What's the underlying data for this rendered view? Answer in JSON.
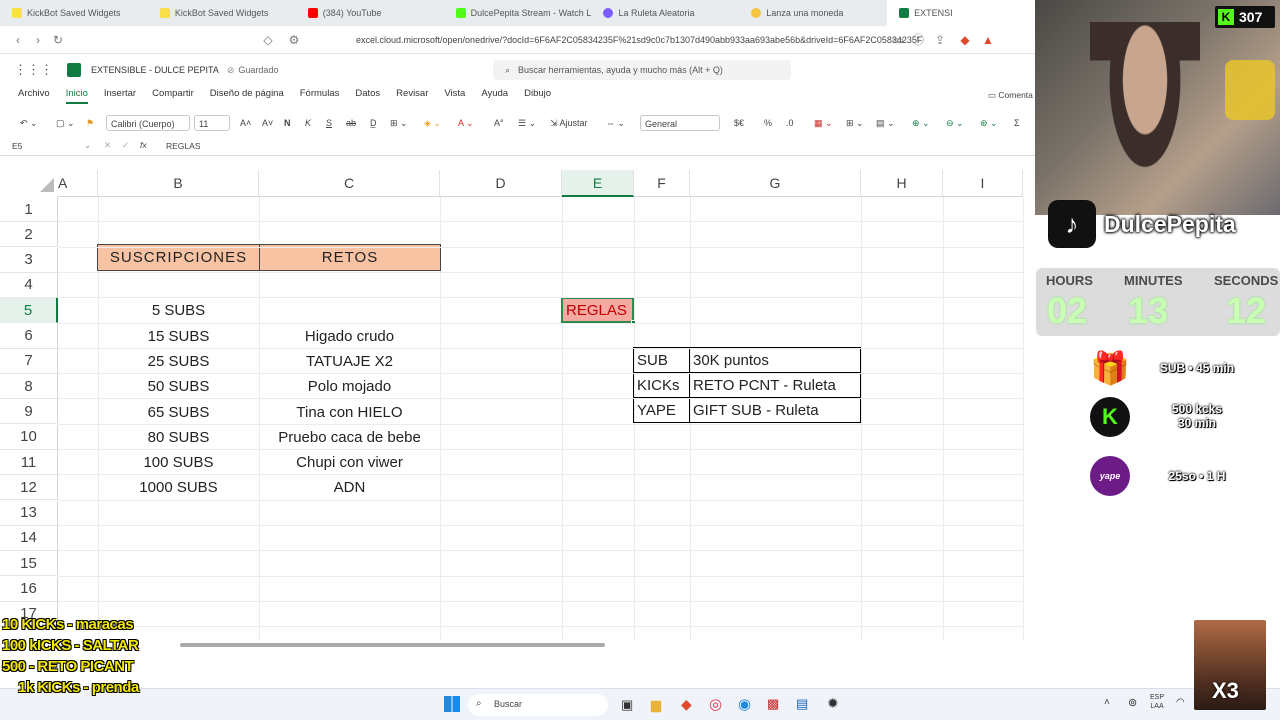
{
  "browser": {
    "tabs": [
      {
        "label": "KickBot Saved Widgets",
        "color": "#f7e04a"
      },
      {
        "label": "KickBot Saved Widgets",
        "color": "#f7e04a"
      },
      {
        "label": "(384) YouTube",
        "color": "#ff0000"
      },
      {
        "label": "DulcePepita Stream - Watch Live",
        "color": "#53fc18"
      },
      {
        "label": "La Ruleta Aleatoria",
        "color": "#7b5cff"
      },
      {
        "label": "Lanza una moneda",
        "color": "#f5c542"
      },
      {
        "label": "EXTENSI",
        "color": "#107c41"
      }
    ],
    "url": "excel.cloud.microsoft/open/onedrive/?docId=6F6AF2C05834235F%21sd9c0c7b1307d490abb933aa693abe56b&driveId=6F6AF2C05834235F"
  },
  "excel": {
    "file_title": "EXTENSIBLE - DULCE PEPITA",
    "save_status": "Guardado",
    "search_placeholder": "Buscar herramientas, ayuda y mucho más (Alt + Q)",
    "menu": [
      "Archivo",
      "Inicio",
      "Insertar",
      "Compartir",
      "Diseño de página",
      "Fórmulas",
      "Datos",
      "Revisar",
      "Vista",
      "Ayuda",
      "Dibujo"
    ],
    "comment_button": "Comenta",
    "font_name": "Calibri (Cuerpo)",
    "font_size": "11",
    "bold": "N",
    "italic": "K",
    "underline": "S",
    "wrap": "Ajustar",
    "number_format": "General",
    "currency": "$€",
    "cell_ref": "E5",
    "formula": "REGLAS",
    "columns": [
      "A",
      "B",
      "C",
      "D",
      "E",
      "F",
      "G",
      "H",
      "I"
    ],
    "rows": [
      "1",
      "2",
      "3",
      "4",
      "5",
      "6",
      "7",
      "8",
      "9",
      "10",
      "11",
      "12",
      "13",
      "14",
      "15",
      "16",
      "17"
    ],
    "headers": {
      "b3": "SUSCRIPCIONES",
      "c3": "RETOS"
    },
    "subs": [
      "5 SUBS",
      "15 SUBS",
      "25 SUBS",
      "50 SUBS",
      "65 SUBS",
      "80 SUBS",
      "100 SUBS",
      "1000 SUBS"
    ],
    "retos": [
      "",
      "Higado crudo",
      "TATUAJE X2",
      "Polo mojado",
      "Tina con HIELO",
      "Pruebo caca de bebe",
      "Chupi con viwer",
      "ADN"
    ],
    "rules_label": "REGLAS",
    "rules_table": [
      {
        "k": "SUB",
        "v": "30K puntos"
      },
      {
        "k": "KICKs",
        "v": "RETO PCNT - Ruleta"
      },
      {
        "k": "YAPE",
        "v": "GIFT SUB - Ruleta"
      }
    ]
  },
  "taskbar": {
    "search": "Buscar",
    "lang1": "ESP",
    "lang2": "LAA"
  },
  "overlay": {
    "kick_viewers": "307",
    "channel": "DulcePepita",
    "timer_labels": [
      "HOURS",
      "MINUTES",
      "SECONDS"
    ],
    "timer_values": [
      "02",
      "13",
      "12"
    ],
    "rewards": [
      {
        "text1": "SUB • 45 min",
        "text2": ""
      },
      {
        "text1": "500 kcks",
        "text2": "30 min"
      },
      {
        "text1": "25so • 1 H",
        "text2": ""
      }
    ],
    "kicks_list": [
      "10 KICKs - maracas",
      "100 kICKS - SALTAR",
      "500 - RETO PICANT",
      "1k KICKs - prenda"
    ],
    "multiplier": "X3",
    "yape_label": "yape"
  }
}
